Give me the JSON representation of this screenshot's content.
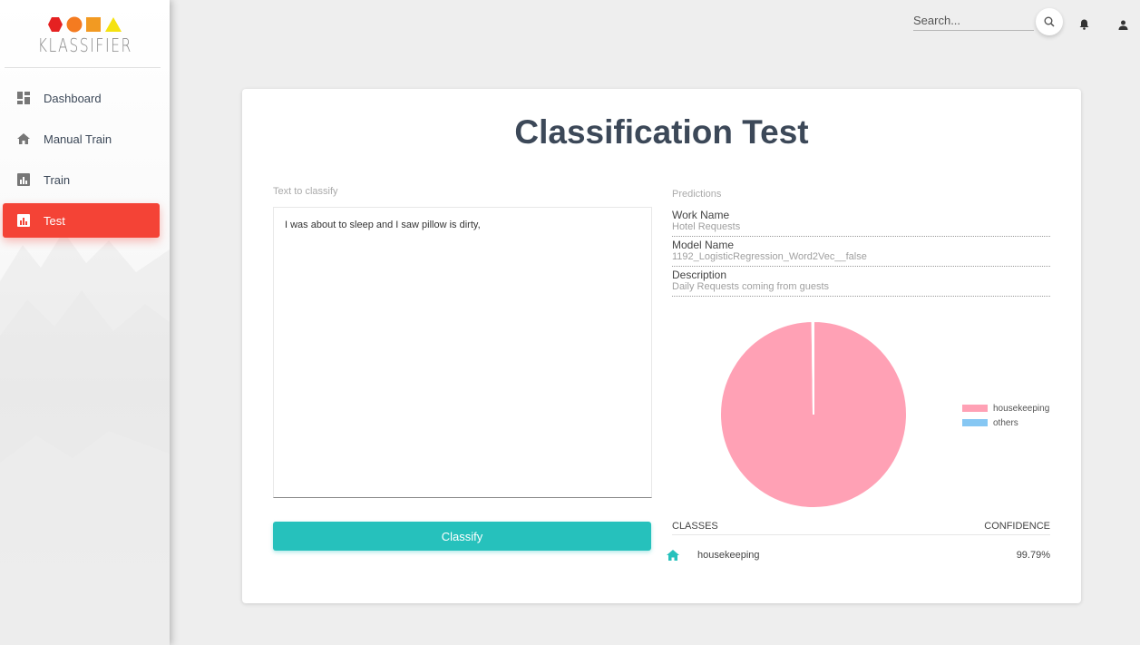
{
  "app": {
    "logo_text": "KLASSIFIER"
  },
  "sidebar": {
    "items": [
      {
        "label": "Dashboard",
        "icon": "dashboard-icon"
      },
      {
        "label": "Manual Train",
        "icon": "home-icon"
      },
      {
        "label": "Train",
        "icon": "bar-chart-icon"
      },
      {
        "label": "Test",
        "icon": "bar-chart-icon",
        "active": true
      }
    ]
  },
  "topbar": {
    "search_placeholder": "Search...",
    "search_icon": "search-icon",
    "notifications_icon": "bell-icon",
    "user_icon": "person-icon"
  },
  "main": {
    "title": "Classification Test",
    "text_label": "Text to classify",
    "text_value": "I was about to sleep and I saw pillow is dirty,",
    "classify_label": "Classify",
    "predictions_label": "Predictions",
    "fields": [
      {
        "name": "Work Name",
        "value": "Hotel Requests"
      },
      {
        "name": "Model Name",
        "value": "1192_LogisticRegression_Word2Vec__false"
      },
      {
        "name": "Description",
        "value": "Daily Requests coming from guests"
      }
    ],
    "table": {
      "col_classes": "CLASSES",
      "col_confidence": "CONFIDENCE",
      "rows": [
        {
          "icon": "home-icon",
          "class": "housekeeping",
          "confidence": "99.79%"
        }
      ]
    }
  },
  "colors": {
    "accent_red": "#f44336",
    "accent_teal": "#26c1bc",
    "pie_housekeeping": "#ffa1b5",
    "pie_others": "#86c7f3"
  },
  "chart_data": {
    "type": "pie",
    "categories": [
      "housekeeping",
      "others"
    ],
    "values": [
      99.79,
      0.21
    ],
    "legend": "right"
  }
}
